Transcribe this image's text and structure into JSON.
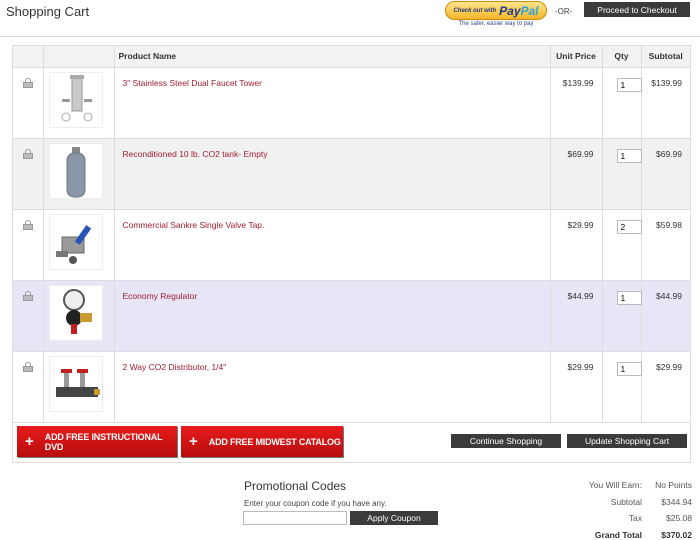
{
  "header": {
    "title": "Shopping Cart",
    "paypal_checkout_small": "Check out with",
    "paypal_logo_a": "Pay",
    "paypal_logo_b": "Pal",
    "paypal_tagline": "The safer, easier way to pay",
    "or_separator": "-OR-",
    "checkout_button": "Proceed to Checkout"
  },
  "table": {
    "columns": [
      "Product Name",
      "Unit Price",
      "Qty",
      "Subtotal"
    ],
    "rows": [
      {
        "name": "3\" Stainless Steel Dual Faucet Tower",
        "price": "$139.99",
        "qty": "1",
        "subtotal": "$139.99",
        "image": "faucet-tower-image"
      },
      {
        "name": "Reconditioned 10 lb. CO2 tank- Empty",
        "price": "$69.99",
        "qty": "1",
        "subtotal": "$69.99",
        "image": "co2-tank-image"
      },
      {
        "name": "Commercial Sankre Single Valve Tap.",
        "price": "$29.99",
        "qty": "2",
        "subtotal": "$59.98",
        "image": "sanke-tap-image"
      },
      {
        "name": "Economy Regulator",
        "price": "$44.99",
        "qty": "1",
        "subtotal": "$44.99",
        "image": "regulator-image"
      },
      {
        "name": "2 Way CO2 Distributor, 1/4\"",
        "price": "$29.99",
        "qty": "1",
        "subtotal": "$29.99",
        "image": "distributor-image"
      }
    ]
  },
  "actions": {
    "add_dvd": "ADD FREE INSTRUCTIONAL DVD",
    "add_catalog": "ADD FREE MIDWEST CATALOG",
    "plus": "+",
    "continue_shopping": "Continue Shopping",
    "update_cart": "Update Shopping Cart"
  },
  "promo": {
    "title": "Promotional Codes",
    "hint": "Enter your coupon code if you have any.",
    "coupon_value": "",
    "apply_button": "Apply Coupon"
  },
  "totals": {
    "earn_label": "You Will Earn:",
    "earn_value": "No Points",
    "subtotal_label": "Subtotal",
    "subtotal_value": "$344.94",
    "tax_label": "Tax",
    "tax_value": "$25.08",
    "grand_label": "Grand Total",
    "grand_value": "$370.02"
  },
  "colors": {
    "accent_red": "#c8101a",
    "product_link": "#a01d30",
    "dark_button": "#3b3b3b",
    "highlight_row": "#e6e6f7"
  }
}
